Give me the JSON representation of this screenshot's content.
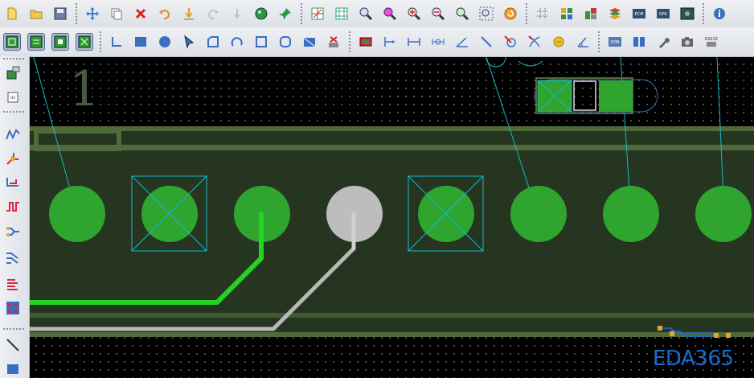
{
  "toolbar_top": {
    "buttons": [
      {
        "icon": "new-file-icon"
      },
      {
        "icon": "open-folder-icon"
      },
      {
        "icon": "save-icon"
      },
      {
        "icon": "move-icon"
      },
      {
        "icon": "copy-icon"
      },
      {
        "icon": "delete-icon"
      },
      {
        "icon": "undo-icon"
      },
      {
        "icon": "download-icon"
      },
      {
        "icon": "redo-icon"
      },
      {
        "icon": "arrow-down-icon"
      },
      {
        "icon": "highlight-icon"
      },
      {
        "icon": "pin-icon"
      },
      {
        "icon": "grid-view-icon"
      },
      {
        "icon": "grid-snap-icon"
      },
      {
        "icon": "zoom-window-icon"
      },
      {
        "icon": "zoom-area-icon"
      },
      {
        "icon": "zoom-in-icon"
      },
      {
        "icon": "zoom-out-icon"
      },
      {
        "icon": "zoom-previous-icon"
      },
      {
        "icon": "zoom-extents-icon"
      },
      {
        "icon": "refresh-icon"
      },
      {
        "icon": "hash-grid-icon"
      },
      {
        "icon": "components-icon"
      },
      {
        "icon": "library-icon"
      },
      {
        "icon": "layers-icon"
      },
      {
        "icon": "ecm-icon"
      },
      {
        "icon": "dfa-icon"
      },
      {
        "icon": "board-icon"
      },
      {
        "icon": "info-icon"
      }
    ],
    "labels": {
      "ecm": "ECM",
      "dfa": "DFA"
    }
  },
  "toolbar_second": {
    "buttons": [
      {
        "icon": "select-mode-1-icon",
        "pressed": true
      },
      {
        "icon": "select-mode-2-icon",
        "pressed": true
      },
      {
        "icon": "select-mode-3-icon",
        "pressed": true
      },
      {
        "icon": "select-mode-4-icon",
        "pressed": true
      },
      {
        "icon": "corner-icon"
      },
      {
        "icon": "rectangle-icon"
      },
      {
        "icon": "circle-icon"
      },
      {
        "icon": "pointer-icon"
      },
      {
        "icon": "polygon-icon"
      },
      {
        "icon": "arc-icon"
      },
      {
        "icon": "square-icon"
      },
      {
        "icon": "rounded-square-icon"
      },
      {
        "icon": "fill-icon"
      },
      {
        "icon": "eraser-icon"
      },
      {
        "icon": "component-icon"
      },
      {
        "icon": "dimension-icon"
      },
      {
        "icon": "dimension-horizontal-icon"
      },
      {
        "icon": "dimension-arc-icon"
      },
      {
        "icon": "angle-icon"
      },
      {
        "icon": "line-icon"
      },
      {
        "icon": "no-connect-icon"
      },
      {
        "icon": "cross-icon"
      },
      {
        "icon": "coin-icon"
      },
      {
        "icon": "angle-measure-icon"
      },
      {
        "icon": "odb-icon"
      },
      {
        "icon": "book-icon"
      },
      {
        "icon": "wrench-icon"
      },
      {
        "icon": "camera-icon"
      },
      {
        "icon": "rs-icon"
      }
    ],
    "labels": {
      "odb": "ODB",
      "rs": "RS232"
    }
  },
  "left_toolbar": {
    "buttons": [
      {
        "icon": "add-component-icon"
      },
      {
        "icon": "u1-chip-icon"
      },
      {
        "icon": "route-icon"
      },
      {
        "icon": "via-route-icon"
      },
      {
        "icon": "layer-route-icon"
      },
      {
        "icon": "length-tune-icon"
      },
      {
        "icon": "diff-pair-icon"
      },
      {
        "icon": "multi-route-icon"
      },
      {
        "icon": "bus-route-icon"
      },
      {
        "icon": "bga-fanout-icon"
      },
      {
        "icon": "line-draw-icon"
      },
      {
        "icon": "rect-draw-icon"
      }
    ],
    "labels": {
      "u1": "U1"
    }
  },
  "canvas": {
    "silk_text": "1",
    "watermark": "EDA365",
    "colors": {
      "background": "#000000",
      "board_band": "#263520",
      "copper_outline": "#4f6b3a",
      "pad": "#2fa52f",
      "pad_selected": "#bdbdbd",
      "ratsnest": "#18b8c8",
      "trace_green": "#22d422",
      "trace_gray": "#b8b8b8"
    },
    "pads": [
      {
        "label": ""
      },
      {
        "label": ""
      },
      {
        "label": ""
      },
      {
        "label": ""
      },
      {
        "label": ""
      },
      {
        "label": ""
      },
      {
        "label": ""
      },
      {
        "label": ""
      }
    ]
  }
}
